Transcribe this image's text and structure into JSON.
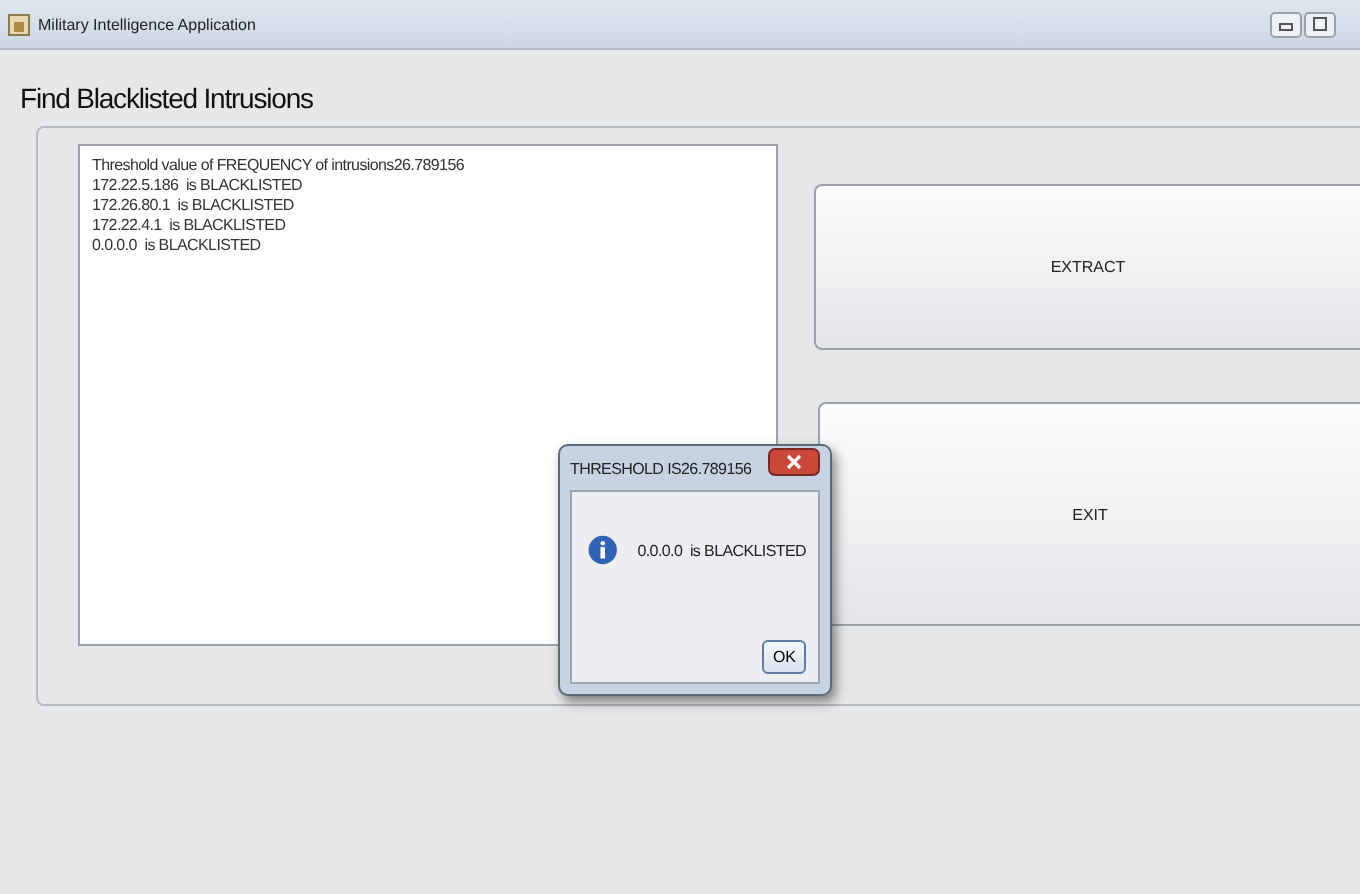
{
  "window": {
    "title": "Military Intelligence Application"
  },
  "heading": "Find Blacklisted Intrusions",
  "output_lines": [
    "Threshold value of FREQUENCY of intrusions26.789156",
    "172.22.5.186  is BLACKLISTED",
    "172.26.80.1  is BLACKLISTED",
    "172.22.4.1  is BLACKLISTED",
    "0.0.0.0  is BLACKLISTED"
  ],
  "buttons": [
    {
      "label": "EXTRACT"
    },
    {
      "label": "EXIT"
    }
  ],
  "dialog": {
    "title": "THRESHOLD IS26.789156",
    "message": "0.0.0.0  is BLACKLISTED",
    "button": "OK"
  }
}
